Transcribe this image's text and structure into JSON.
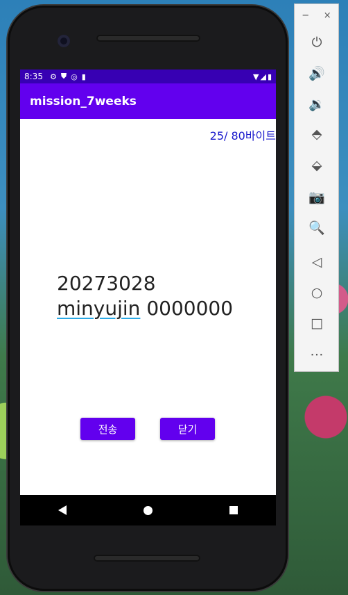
{
  "status_bar": {
    "time": "8:35"
  },
  "app_bar": {
    "title": "mission_7weeks"
  },
  "content": {
    "byte_counter": "25/ 80바이트",
    "message_line1": "20273028",
    "message_line2_word": "minyujin",
    "message_line2_rest": " 0000000"
  },
  "buttons": {
    "send_label": "전송",
    "close_label": "닫기"
  },
  "colors": {
    "primary": "#6200ee",
    "primary_dark": "#3700b3",
    "counter_text": "#1a1acc"
  },
  "emulator_panel": {
    "minimize_label": "−",
    "close_label": "×",
    "icons": [
      "power-icon",
      "volume-up-icon",
      "volume-down-icon",
      "rotate-left-icon",
      "rotate-right-icon",
      "camera-icon",
      "zoom-icon",
      "back-icon",
      "home-icon",
      "overview-icon",
      "more-icon"
    ]
  }
}
